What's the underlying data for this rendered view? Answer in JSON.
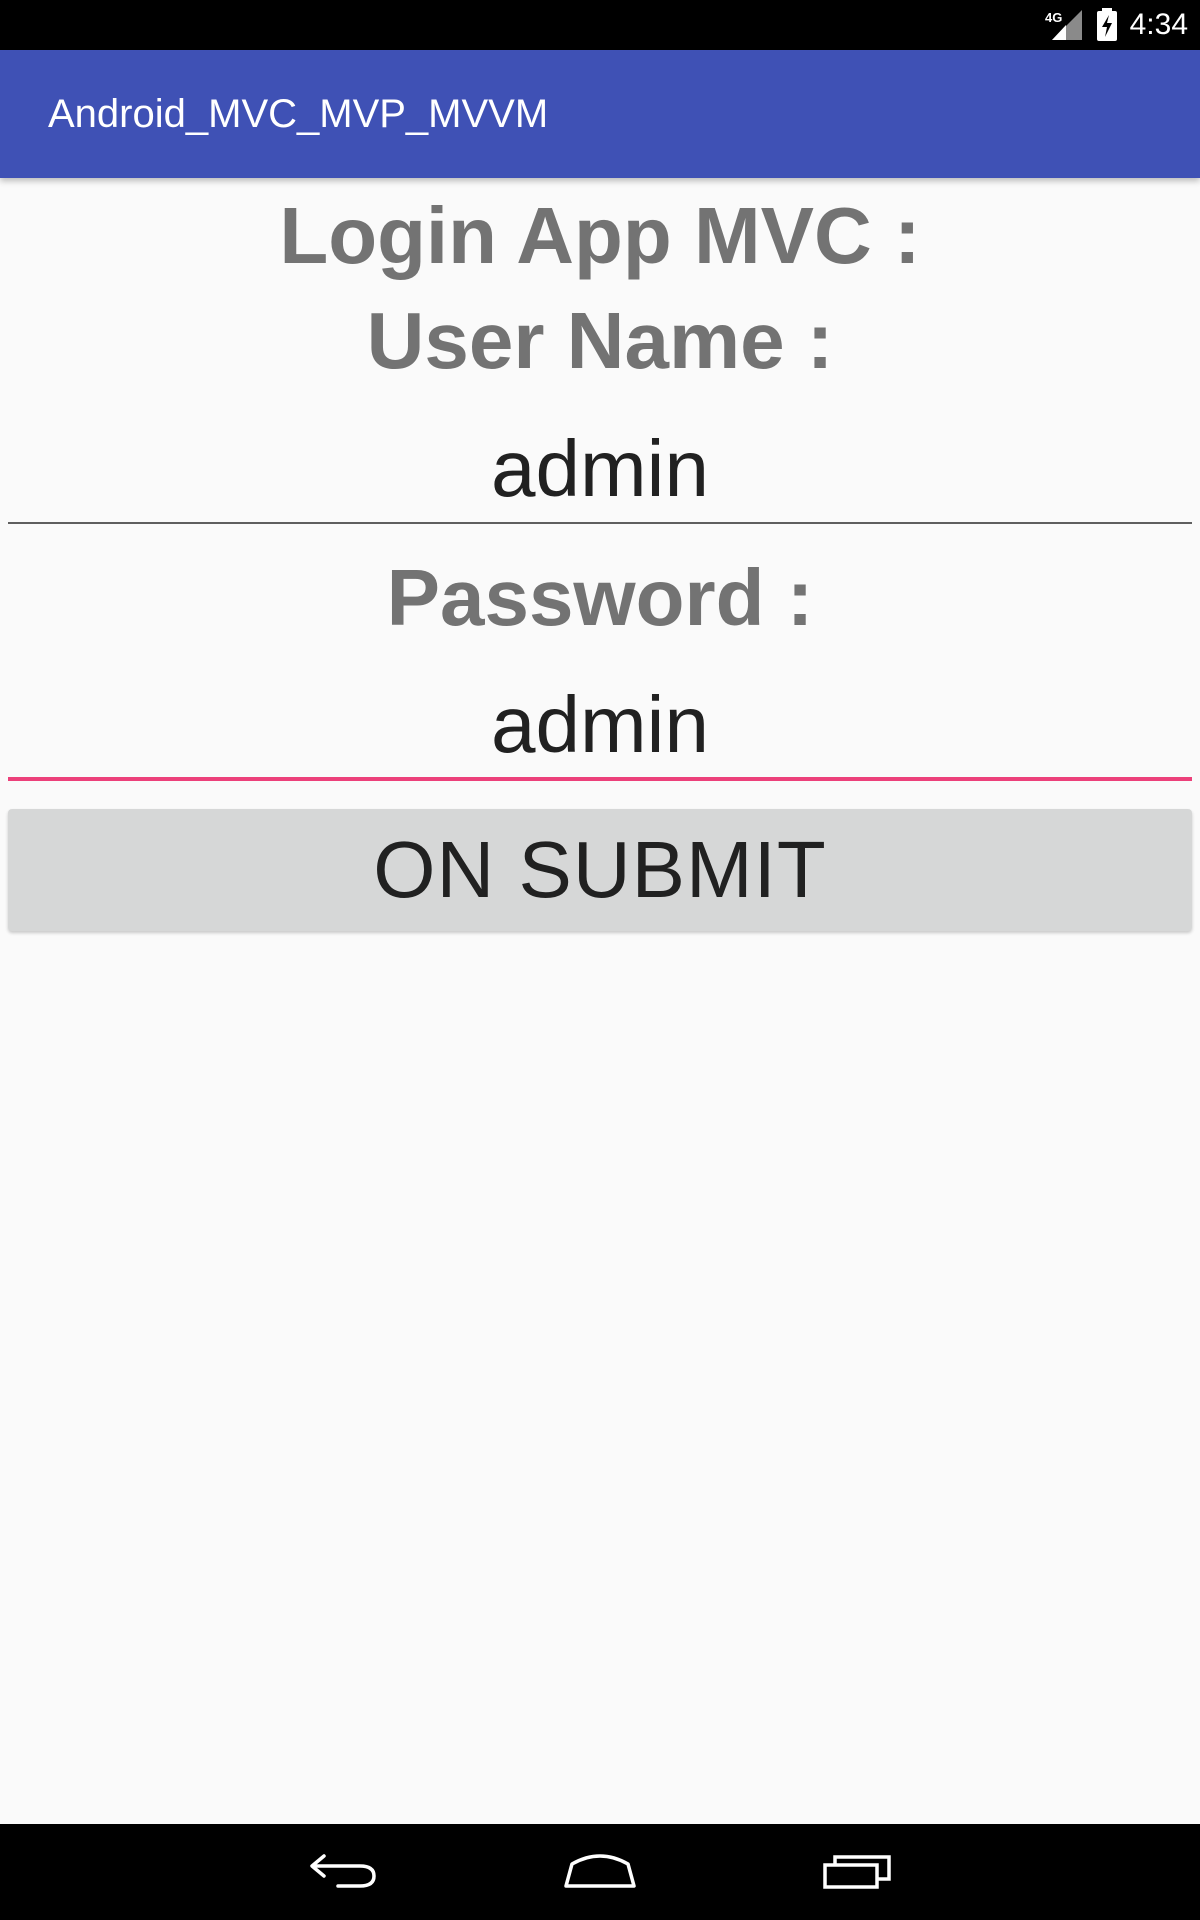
{
  "status_bar": {
    "network_label": "4G",
    "time": "4:34",
    "icons": [
      "signal-icon",
      "battery-charging-icon"
    ]
  },
  "app_bar": {
    "title": "Android_MVC_MVP_MVVM",
    "color": "#3f51b5"
  },
  "form": {
    "title": "Login App MVC :",
    "username_label": "User Name :",
    "username_value": "admin",
    "password_label": "Password :",
    "password_value": "admin",
    "submit_label": "ON SUBMIT",
    "focus_color": "#ec407a"
  },
  "nav_bar": {
    "icons": [
      "back-icon",
      "home-icon",
      "recents-icon"
    ]
  }
}
